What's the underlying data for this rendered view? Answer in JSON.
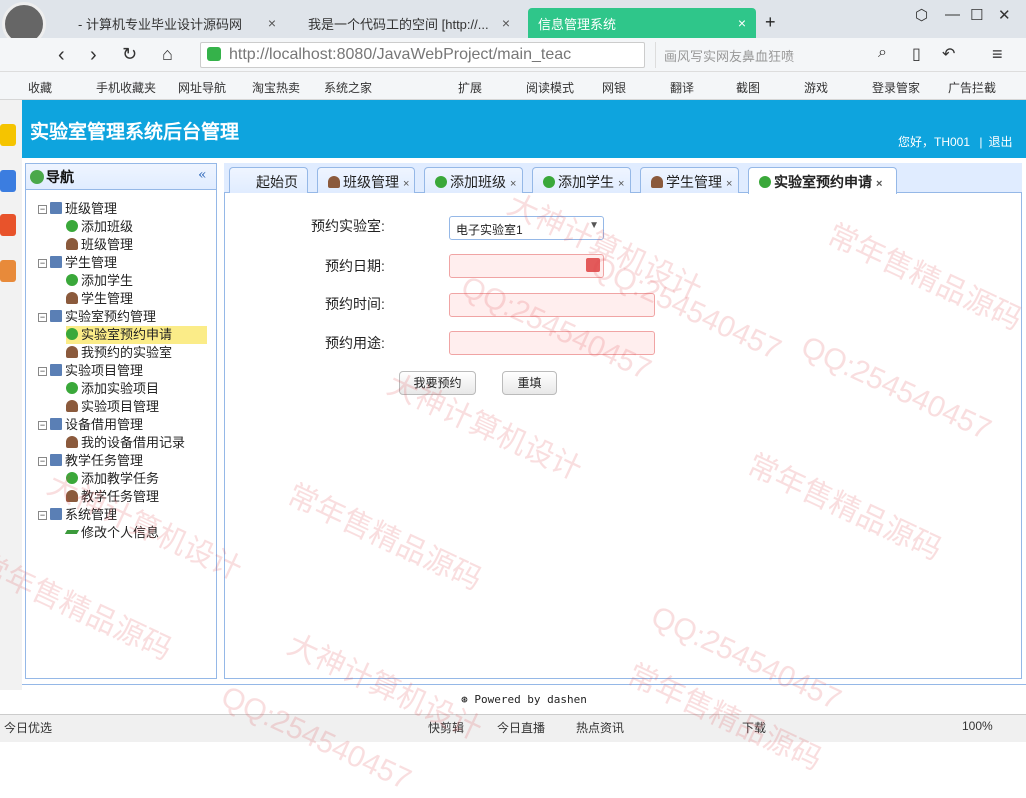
{
  "browser": {
    "tabs": [
      {
        "label": "- 计算机专业毕业设计源码网",
        "close": "×"
      },
      {
        "label": "我是一个代码工的空间 [http://...",
        "close": "×"
      },
      {
        "label": "信息管理系统",
        "close": "×"
      }
    ],
    "new_tab": "+",
    "url_host": "http://localhost",
    "url_rest": ":8080/JavaWebProject/main_teac",
    "search_placeholder": "画风写实网友鼻血狂喷",
    "bookmarks": [
      "收藏",
      "手机收藏夹",
      "网址导航",
      "淘宝热卖",
      "系统之家",
      "扩展",
      "阅读模式",
      "网银",
      "翻译",
      "截图",
      "游戏",
      "登录管家",
      "广告拦截"
    ]
  },
  "app": {
    "title": "实验室管理系统后台管理",
    "greeting": "您好，TH001",
    "separator": "|",
    "logout": "退出",
    "nav_title": "导航",
    "collapse": "«"
  },
  "tree": [
    {
      "label": "班级管理",
      "level": 1,
      "icon": "pc",
      "expand": "−"
    },
    {
      "label": "添加班级",
      "level": 2,
      "icon": "add"
    },
    {
      "label": "班级管理",
      "level": 2,
      "icon": "user"
    },
    {
      "label": "学生管理",
      "level": 1,
      "icon": "pc",
      "expand": "−"
    },
    {
      "label": "添加学生",
      "level": 2,
      "icon": "add"
    },
    {
      "label": "学生管理",
      "level": 2,
      "icon": "user"
    },
    {
      "label": "实验室预约管理",
      "level": 1,
      "icon": "pc",
      "expand": "−"
    },
    {
      "label": "实验室预约申请",
      "level": 2,
      "icon": "add",
      "selected": true
    },
    {
      "label": "我预约的实验室",
      "level": 2,
      "icon": "user"
    },
    {
      "label": "实验项目管理",
      "level": 1,
      "icon": "pc",
      "expand": "−"
    },
    {
      "label": "添加实验项目",
      "level": 2,
      "icon": "add"
    },
    {
      "label": "实验项目管理",
      "level": 2,
      "icon": "user"
    },
    {
      "label": "设备借用管理",
      "level": 1,
      "icon": "pc",
      "expand": "−"
    },
    {
      "label": "我的设备借用记录",
      "level": 2,
      "icon": "user"
    },
    {
      "label": "教学任务管理",
      "level": 1,
      "icon": "pc",
      "expand": "−"
    },
    {
      "label": "添加教学任务",
      "level": 2,
      "icon": "add"
    },
    {
      "label": "教学任务管理",
      "level": 2,
      "icon": "user"
    },
    {
      "label": "系统管理",
      "level": 1,
      "icon": "pc",
      "expand": "−"
    },
    {
      "label": "修改个人信息",
      "level": 2,
      "icon": "edit"
    }
  ],
  "tabs": [
    {
      "label": "起始页",
      "icon": "none"
    },
    {
      "label": "班级管理",
      "icon": "user",
      "close": "×"
    },
    {
      "label": "添加班级",
      "icon": "add",
      "close": "×"
    },
    {
      "label": "添加学生",
      "icon": "add",
      "close": "×"
    },
    {
      "label": "学生管理",
      "icon": "user",
      "close": "×"
    },
    {
      "label": "实验室预约申请",
      "icon": "add",
      "close": "×",
      "active": true
    }
  ],
  "form": {
    "lab_label": "预约实验室:",
    "lab_value": "电子实验室1",
    "date_label": "预约日期:",
    "date_value": "",
    "time_label": "预约时间:",
    "time_value": "",
    "purpose_label": "预约用途:",
    "purpose_value": "",
    "submit": "我要预约",
    "reset": "重填"
  },
  "footer": "Powered by dashen",
  "status": {
    "left": "今日优选",
    "items": [
      "快剪辑",
      "今日直播",
      "热点资讯",
      "下载"
    ],
    "zoom": "100%"
  },
  "watermarks": [
    "大神计算机设计",
    "QQ:254540457",
    "常年售精品源码",
    "QQ:254540457",
    "大神计算机设计",
    "常年售精品源码",
    "QQ:254540457",
    "常年售精品源码",
    "QQ:254540457",
    "大神计算机设计",
    "常年售精品源码",
    "QQ:254540457",
    "大神计算机设计",
    "常年售精品源码"
  ],
  "colors": {
    "header": "#0ea4de",
    "active_tab": "#2fc68a",
    "panel_border": "#95b8e7"
  }
}
